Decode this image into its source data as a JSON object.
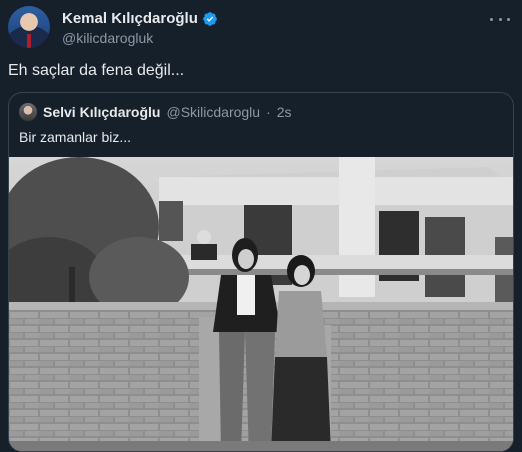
{
  "tweet": {
    "author_name": "Kemal Kılıçdaroğlu",
    "author_handle": "@kilicdarogluk",
    "text": "Eh saçlar da fena değil...",
    "icons": {
      "verified": "verified-badge-icon",
      "more": "more-options-icon"
    },
    "colors": {
      "background": "#15202b",
      "verified": "#1d9bf0",
      "muted": "#8b98a5",
      "border": "#38444d"
    }
  },
  "quoted_tweet": {
    "author_name": "Selvi Kılıçdaroğlu",
    "author_handle": "@Skilicdaroglu",
    "separator": "·",
    "time": "2s",
    "text": "Bir zamanlar biz..."
  }
}
